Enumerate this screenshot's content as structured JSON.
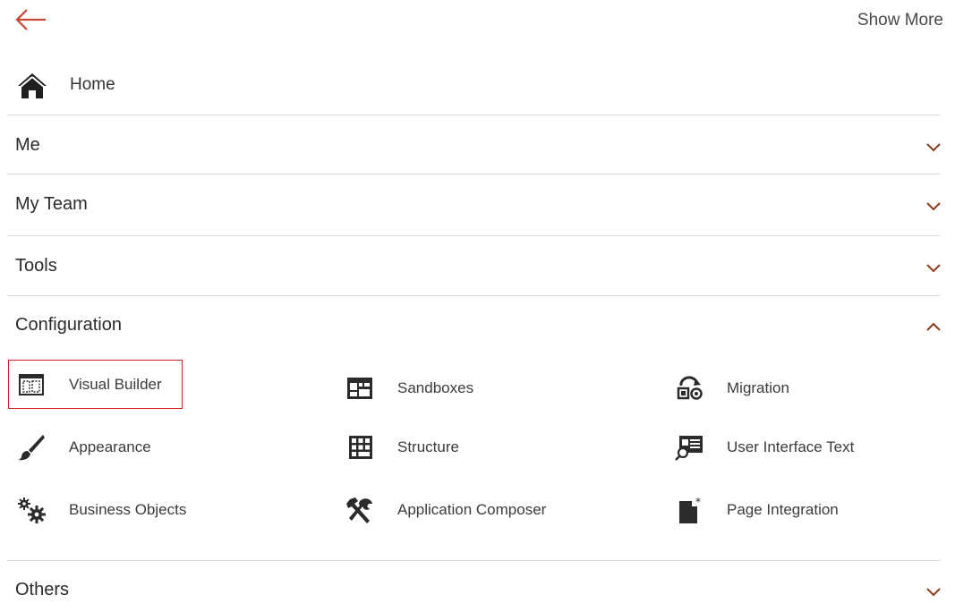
{
  "header": {
    "back_icon": "arrow-left-icon",
    "show_more_label": "Show More",
    "accent_color": "#c74634"
  },
  "home": {
    "icon": "home-icon",
    "label": "Home"
  },
  "sections": [
    {
      "label": "Me",
      "expanded": false
    },
    {
      "label": "My Team",
      "expanded": false
    },
    {
      "label": "Tools",
      "expanded": false
    },
    {
      "label": "Configuration",
      "expanded": true
    },
    {
      "label": "Others",
      "expanded": false
    }
  ],
  "configuration_items": [
    {
      "label": "Visual Builder",
      "icon": "visual-builder-icon",
      "selected": true
    },
    {
      "label": "Sandboxes",
      "icon": "sandboxes-icon"
    },
    {
      "label": "Migration",
      "icon": "migration-icon"
    },
    {
      "label": "Appearance",
      "icon": "paintbrush-icon"
    },
    {
      "label": "Structure",
      "icon": "structure-grid-icon"
    },
    {
      "label": "User Interface Text",
      "icon": "ui-text-search-icon"
    },
    {
      "label": "Business Objects",
      "icon": "gears-icon"
    },
    {
      "label": "Application Composer",
      "icon": "tools-icon"
    },
    {
      "label": "Page Integration",
      "icon": "page-integration-icon"
    }
  ],
  "colors": {
    "chevron": "#8b3a1a",
    "selection_border": "#d41f1f",
    "separator": "#dcdcdc"
  }
}
